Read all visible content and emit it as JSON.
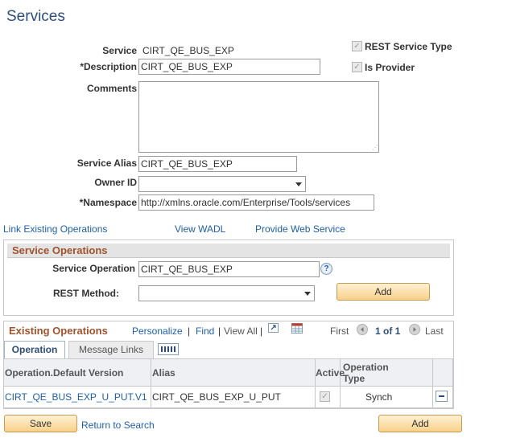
{
  "page": {
    "title": "Services"
  },
  "form": {
    "service_label": "Service",
    "service_value": "CIRT_QE_BUS_EXP",
    "description_label": "*Description",
    "description_value": "CIRT_QE_BUS_EXP",
    "comments_label": "Comments",
    "comments_value": "",
    "rest_service_type_label": "REST Service Type",
    "rest_service_type_checked": true,
    "is_provider_label": "Is Provider",
    "is_provider_checked": true,
    "service_alias_label": "Service Alias",
    "service_alias_value": "CIRT_QE_BUS_EXP",
    "owner_id_label": "Owner ID",
    "owner_id_value": "",
    "namespace_label": "*Namespace",
    "namespace_value": "http://xmlns.oracle.com/Enterprise/Tools/services"
  },
  "links": {
    "link_existing": "Link Existing Operations",
    "view_wadl": "View WADL",
    "provide_web_service": "Provide Web Service"
  },
  "service_operations": {
    "header": "Service Operations",
    "service_operation_label": "Service Operation",
    "service_operation_value": "CIRT_QE_BUS_EXP",
    "help_glyph": "?",
    "rest_method_label": "REST Method:",
    "rest_method_value": "",
    "add_button": "Add"
  },
  "existing_operations": {
    "header": "Existing Operations",
    "personalize": "Personalize",
    "sep1": "|",
    "find": "Find",
    "sep2": "|",
    "view_all": "View All",
    "sep3": "|",
    "first": "First",
    "pager": "1 of 1",
    "last": "Last",
    "tabs": [
      {
        "label": "Operation",
        "active": true
      },
      {
        "label": "Message Links",
        "active": false
      }
    ],
    "columns": {
      "operation": "Operation.Default Version",
      "alias": "Alias",
      "active": "Active",
      "operation_type_line1": "Operation",
      "operation_type_line2": "Type"
    },
    "rows": [
      {
        "operation": "CIRT_QE_BUS_EXP_U_PUT.V1",
        "alias": "CIRT_QE_BUS_EXP_U_PUT",
        "active": true,
        "type": "Synch"
      }
    ]
  },
  "footer": {
    "save_button": "Save",
    "return_to_search": "Return to Search",
    "add_button": "Add"
  },
  "colors": {
    "title": "#2e4d7b",
    "link": "#1f5fa8",
    "group_header": "#a0522d",
    "button_border": "#c29c52"
  },
  "icons": [
    "help-icon",
    "zoom-icon",
    "download-grid-icon",
    "first-arrow-icon",
    "last-arrow-icon",
    "show-all-columns-icon",
    "delete-row-icon",
    "checkbox-checked-icon",
    "dropdown-arrow-icon",
    "resize-grip-icon"
  ]
}
